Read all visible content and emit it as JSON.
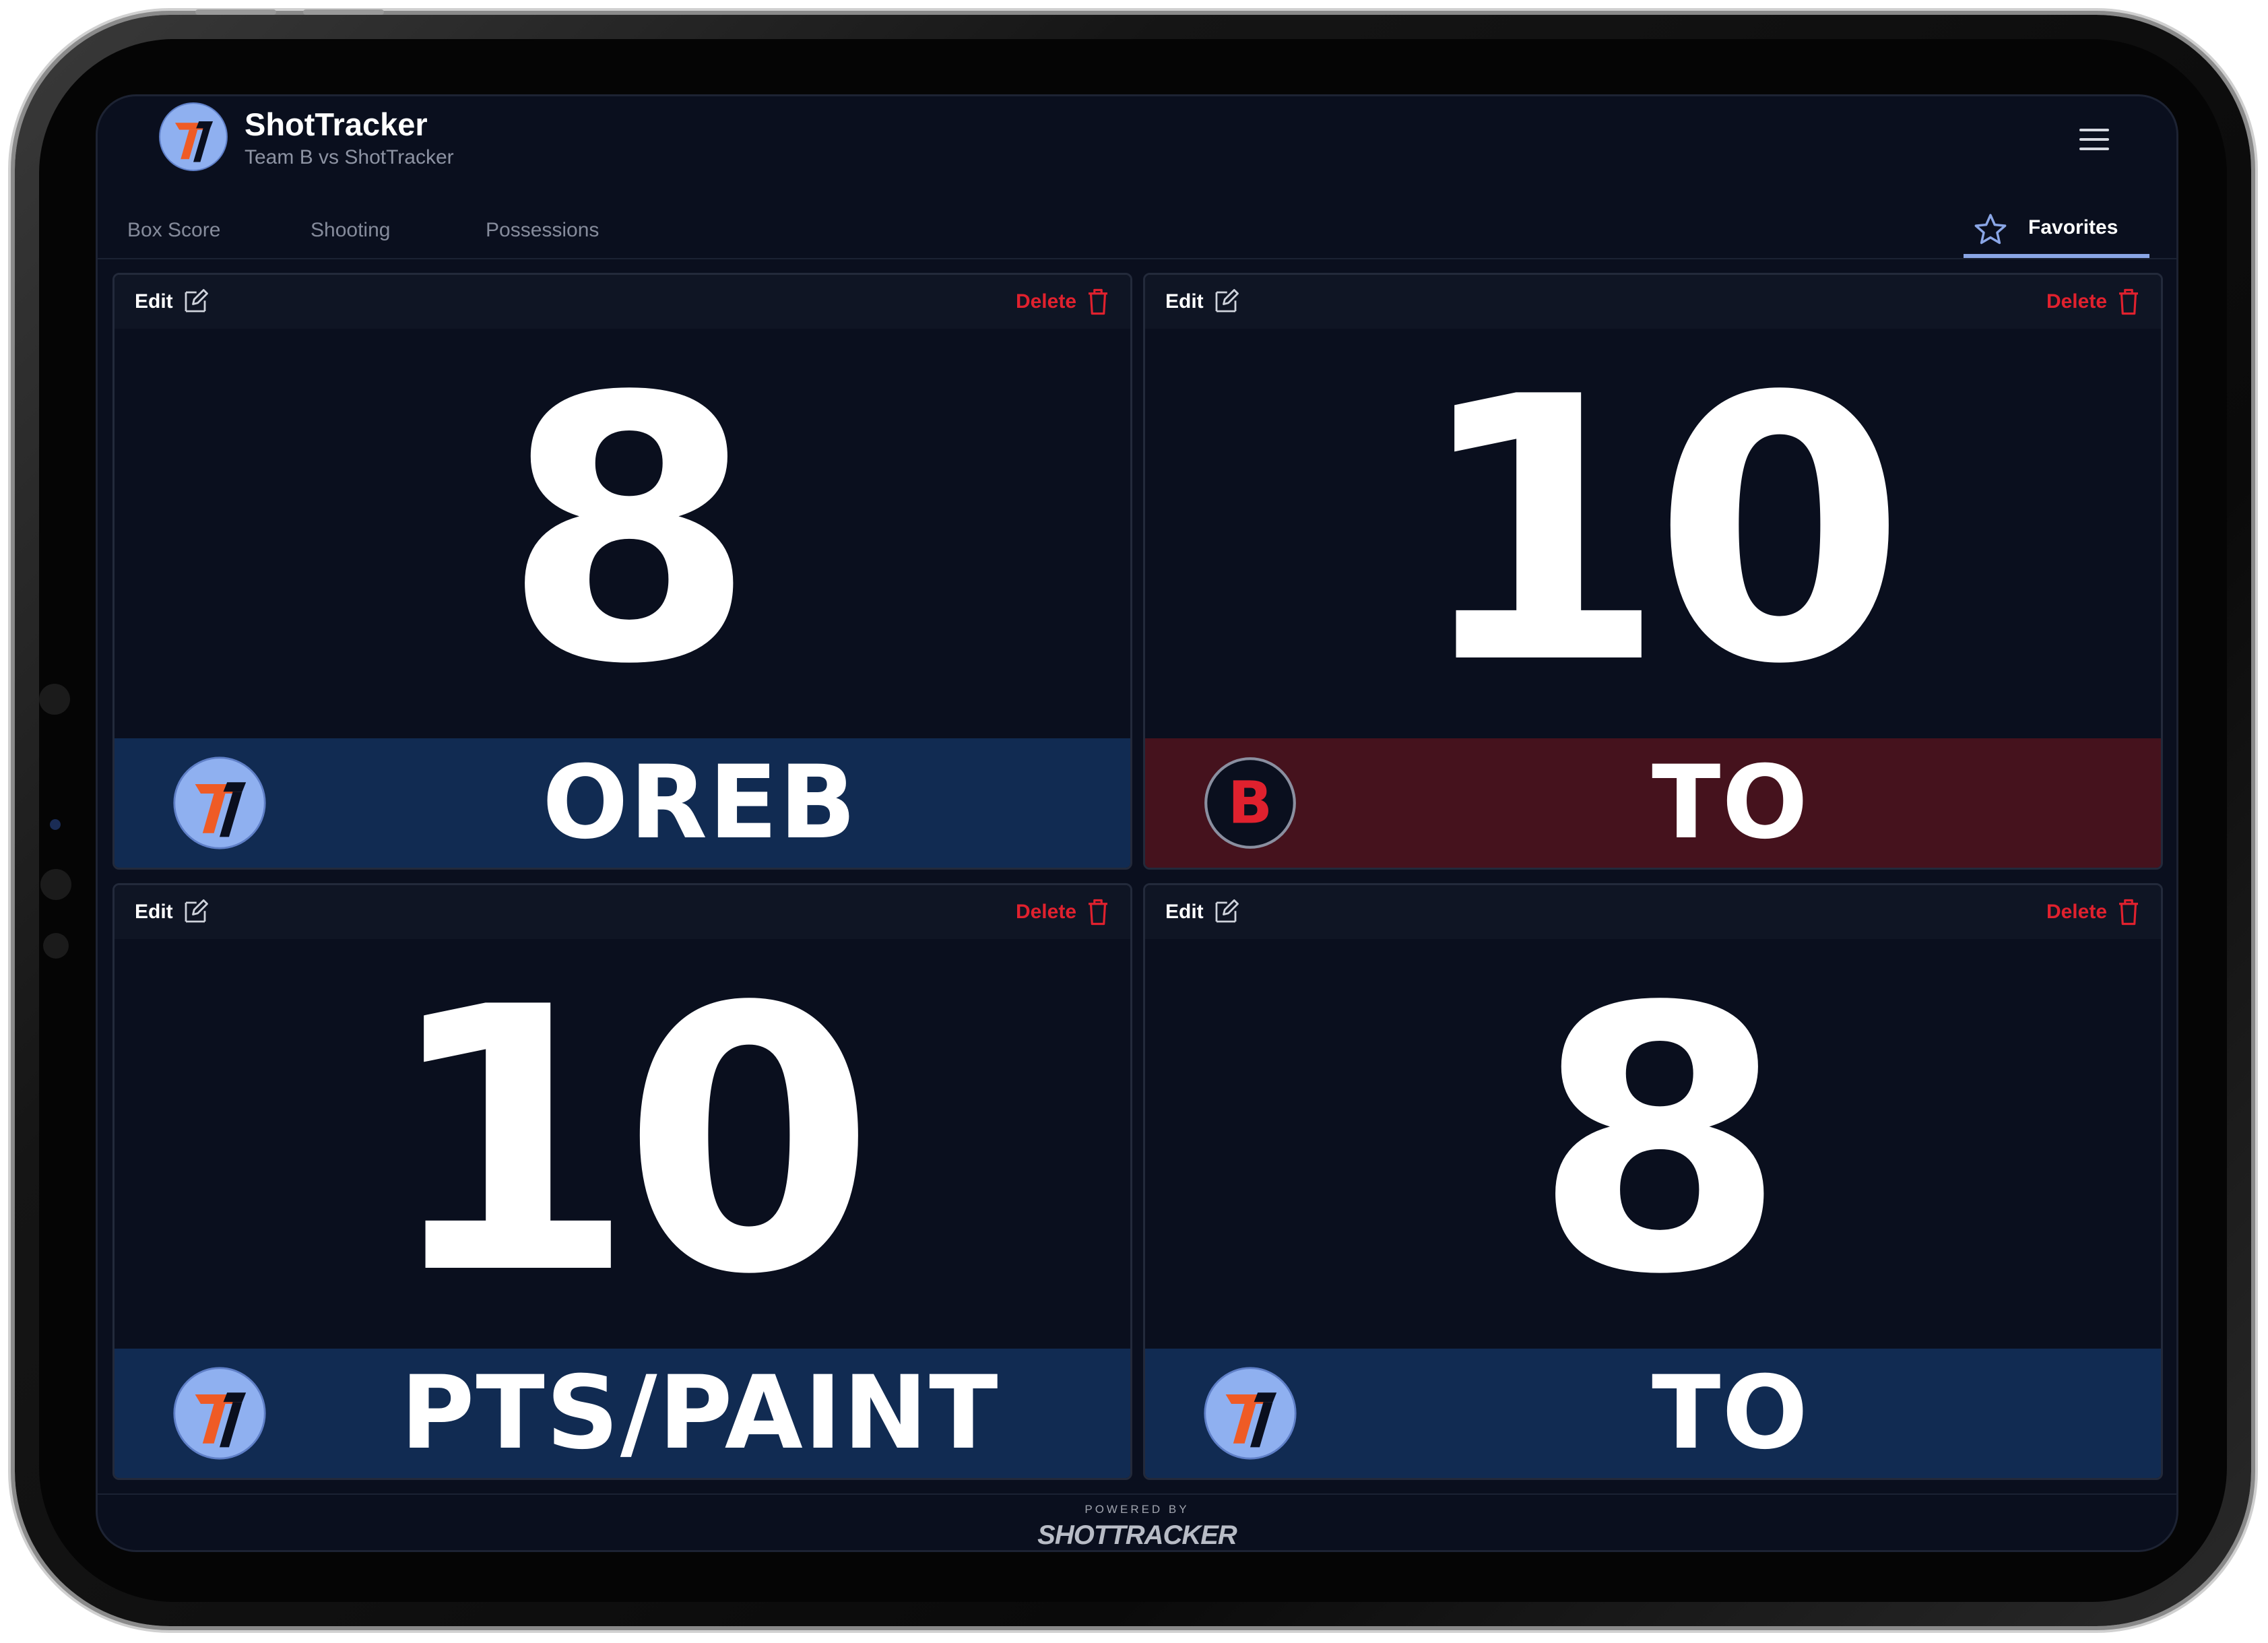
{
  "app": {
    "title": "ShotTracker",
    "subtitle": "Team B vs ShotTracker",
    "logo_icon": "shottracker-logo"
  },
  "tabs": [
    {
      "label": "Box Score"
    },
    {
      "label": "Shooting"
    },
    {
      "label": "Possessions"
    }
  ],
  "favorites_tab": {
    "label": "Favorites",
    "icon": "star-icon",
    "active": true
  },
  "card_actions": {
    "edit": "Edit",
    "delete": "Delete"
  },
  "cards": [
    {
      "value": "8",
      "stat": "OREB",
      "team": "ShotTracker",
      "team_badge": "shottracker-logo"
    },
    {
      "value": "10",
      "stat": "TO",
      "team": "Team B",
      "team_badge_text": "B"
    },
    {
      "value": "10",
      "stat": "PTS/PAINT",
      "team": "ShotTracker",
      "team_badge": "shottracker-logo"
    },
    {
      "value": "8",
      "stat": "TO",
      "team": "ShotTracker",
      "team_badge": "shottracker-logo"
    }
  ],
  "footer": {
    "powered_by": "POWERED BY",
    "brand": "SHOTTRACKER"
  },
  "colors": {
    "background": "#0a0f1e",
    "shottracker_bar": "#112b52",
    "team_b_bar": "#45121d",
    "delete": "#e0212e",
    "accent": "#8aa6e6",
    "logo_orange": "#ef5b25",
    "logo_blue": "#8fb0f0"
  }
}
